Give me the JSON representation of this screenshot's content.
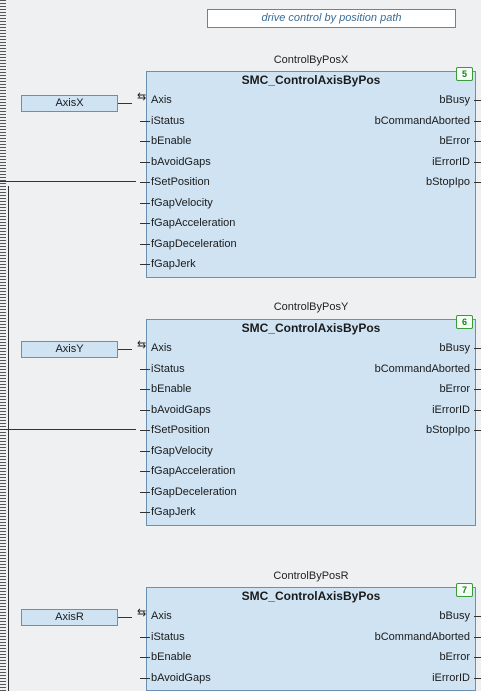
{
  "comment": "drive control by position path",
  "blocks": [
    {
      "instance": "ControlByPosX",
      "type": "SMC_ControlAxisByPos",
      "badge": "5",
      "variable": "AxisX",
      "inputs": [
        "Axis",
        "iStatus",
        "bEnable",
        "bAvoidGaps",
        "fSetPosition",
        "fGapVelocity",
        "fGapAcceleration",
        "fGapDeceleration",
        "fGapJerk"
      ],
      "outputs": [
        "bBusy",
        "bCommandAborted",
        "bError",
        "iErrorID",
        "bStopIpo"
      ]
    },
    {
      "instance": "ControlByPosY",
      "type": "SMC_ControlAxisByPos",
      "badge": "6",
      "variable": "AxisY",
      "inputs": [
        "Axis",
        "iStatus",
        "bEnable",
        "bAvoidGaps",
        "fSetPosition",
        "fGapVelocity",
        "fGapAcceleration",
        "fGapDeceleration",
        "fGapJerk"
      ],
      "outputs": [
        "bBusy",
        "bCommandAborted",
        "bError",
        "iErrorID",
        "bStopIpo"
      ]
    },
    {
      "instance": "ControlByPosR",
      "type": "SMC_ControlAxisByPos",
      "badge": "7",
      "variable": "AxisR",
      "inputs": [
        "Axis",
        "iStatus",
        "bEnable",
        "bAvoidGaps"
      ],
      "outputs": [
        "bBusy",
        "bCommandAborted",
        "bError",
        "iErrorID"
      ]
    }
  ]
}
